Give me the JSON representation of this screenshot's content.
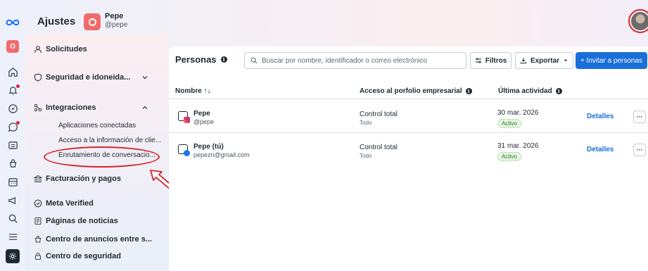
{
  "brand": {
    "logo_icon": "meta-infinity-logo"
  },
  "rail": {
    "account_initial": "O",
    "icons": [
      "home-icon",
      "bell-icon",
      "compass-icon",
      "chat-icon",
      "pages-icon",
      "ads-icon",
      "calendar-icon",
      "megaphone-icon",
      "search-icon",
      "list-icon",
      "settings-icon"
    ]
  },
  "header": {
    "title": "Ajustes",
    "account_initial": "O",
    "account_name": "Pepe",
    "account_handle": "@pepe"
  },
  "sidebar": {
    "requests": "Solicitudes",
    "security": "Seguridad e idoneida...",
    "integrations": "Integraciones",
    "sub_items": [
      "Aplicaciones conectadas",
      "Acceso a la información de clie...",
      "Enrutamiento de conversacio..."
    ],
    "billing": "Facturación y pagos",
    "meta_verified": "Meta Verified",
    "news_pages": "Páginas de noticias",
    "ads_center": "Centro de anuncios entre s...",
    "security_center": "Centro de seguridad"
  },
  "people": {
    "title": "Personas",
    "search_placeholder": "Buscar por nombre, identificador o correo electrónico",
    "filters": "Filtros",
    "export": "Exportar",
    "invite": "+ Invitar a personas",
    "columns": {
      "name": "Nombre ↑↓",
      "access": "Acceso al porfolio empresarial",
      "activity": "Última actividad"
    },
    "rows": [
      {
        "name": "Pepe",
        "sub": "@pepe",
        "access": "Control total",
        "access_sub": "Todo",
        "date": "30 mar. 2026",
        "status": "Activo",
        "details": "Detalles",
        "more": "···"
      },
      {
        "name": "Pepe (tú)",
        "sub": "pepezn@gmail.com",
        "access": "Control total",
        "access_sub": "Todo",
        "date": "31 mar. 2026",
        "status": "Activo",
        "details": "Detalles",
        "more": "···"
      }
    ]
  },
  "colors": {
    "accent": "#1a6ed8",
    "annotation": "#d4262a",
    "active_badge": "#2d7a1e"
  }
}
